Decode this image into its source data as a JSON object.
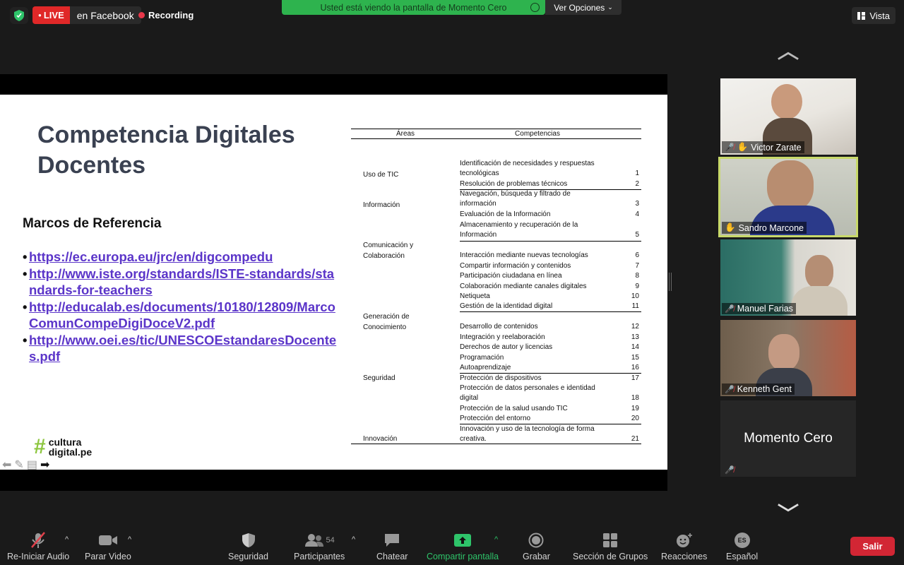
{
  "topbar": {
    "live_label": "LIVE",
    "live_destination": "en Facebook",
    "recording_label": "Recording",
    "share_banner": "Usted está viendo la pantalla de Momento Cero",
    "view_options": "Ver Opciones",
    "view_label": "Vista"
  },
  "slide": {
    "title": "Competencia Digitales Docentes",
    "subtitle": "Marcos de Referencia",
    "links": [
      "https://ec.europa.eu/jrc/en/digcompedu",
      "http://www.iste.org/standards/ISTE-standards/standards-for-teachers",
      "http://educalab.es/documents/10180/12809/MarcoComunCompeDigiDoceV2.pdf",
      "http://www.oei.es/tic/UNESCOEstandaresDocentes.pdf"
    ],
    "logo_line1": "cultura",
    "logo_line2": "digital.pe",
    "table": {
      "header_areas": "Áreas",
      "header_competencias": "Competencias",
      "areas": [
        "Uso de TIC",
        "Información",
        "Comunicación y Colaboración",
        "Generación de Conocimiento",
        "Seguridad",
        "Innovación"
      ],
      "competencias": [
        {
          "text": "Identificación de necesidades y respuestas tecnológicas",
          "num": "1"
        },
        {
          "text": "Resolución de problemas técnicos",
          "num": "2"
        },
        {
          "text": "Navegación, búsqueda y filtrado de información",
          "num": "3"
        },
        {
          "text": "Evaluación de la Información",
          "num": "4"
        },
        {
          "text": "Almacenamiento y recuperación de la Información",
          "num": "5"
        },
        {
          "text": "Interacción mediante nuevas tecnologías",
          "num": "6"
        },
        {
          "text": "Compartir información y contenidos",
          "num": "7"
        },
        {
          "text": "Participación ciudadana en línea",
          "num": "8"
        },
        {
          "text": "Colaboración mediante canales digitales",
          "num": "9"
        },
        {
          "text": "Netiqueta",
          "num": "10"
        },
        {
          "text": "Gestión de la identidad digital",
          "num": "11"
        },
        {
          "text": "Desarrollo de contenidos",
          "num": "12"
        },
        {
          "text": "Integración y reelaboración",
          "num": "13"
        },
        {
          "text": "Derechos de autor y licencias",
          "num": "14"
        },
        {
          "text": "Programación",
          "num": "15"
        },
        {
          "text": "Autoaprendizaje",
          "num": "16"
        },
        {
          "text": "Protección de dispositivos",
          "num": "17"
        },
        {
          "text": "Protección de datos personales e identidad digital",
          "num": "18"
        },
        {
          "text": "Protección de la salud usando TIC",
          "num": "19"
        },
        {
          "text": "Protección del entorno",
          "num": "20"
        },
        {
          "text": "Innovación y uso de la tecnología de forma creativa.",
          "num": "21"
        }
      ]
    }
  },
  "participants": [
    {
      "name": "Victor Zarate"
    },
    {
      "name": "Sandro Marcone"
    },
    {
      "name": "Manuel Farias"
    },
    {
      "name": "Kenneth Gent"
    },
    {
      "name": "Momento Cero"
    }
  ],
  "toolbar": {
    "audio": "Re-Iniciar Audio",
    "video": "Parar Video",
    "security": "Seguridad",
    "participants": "Participantes",
    "participants_count": "54",
    "chat": "Chatear",
    "share": "Compartir pantalla",
    "record": "Grabar",
    "breakout": "Sección de Grupos",
    "reactions": "Reacciones",
    "language": "Español",
    "language_badge": "ES",
    "leave": "Salir"
  },
  "colors": {
    "live": "#e02828",
    "share_banner": "#2eb34e",
    "leave": "#d22634",
    "link": "#5b35c9",
    "active_speaker": "#c8d96a"
  }
}
